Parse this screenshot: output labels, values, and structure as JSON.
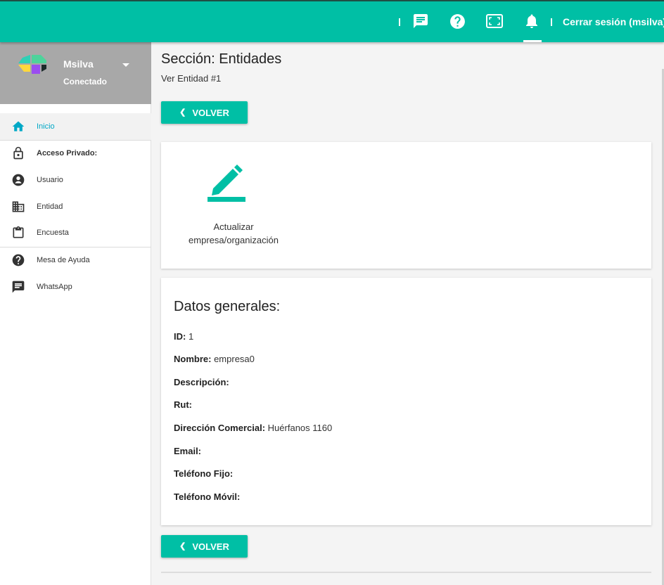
{
  "topbar": {
    "logout_label": "Cerrar sesión (msilva)",
    "icons": [
      "chat-icon",
      "help-icon",
      "fullscreen-icon",
      "bell-icon"
    ],
    "accent": "#00bfa5"
  },
  "profile": {
    "name": "Msilva",
    "status": "Conectado"
  },
  "sidebar": {
    "items": [
      {
        "label": "Inicio",
        "icon": "home-icon"
      },
      {
        "label": "Acceso Privado:",
        "icon": "lock-icon"
      },
      {
        "label": "Usuario",
        "icon": "account-icon"
      },
      {
        "label": "Entidad",
        "icon": "building-icon"
      },
      {
        "label": "Encuesta",
        "icon": "clipboard-icon"
      },
      {
        "label": "Mesa de Ayuda",
        "icon": "help-icon"
      },
      {
        "label": "WhatsApp",
        "icon": "chat-icon"
      }
    ]
  },
  "main": {
    "title": "Sección: Entidades",
    "subtitle": "Ver Entidad #1",
    "back_label": "VOLVER",
    "action_label": "Actualizar empresa/organización",
    "section_title": "Datos generales:",
    "fields": [
      {
        "label": "ID:",
        "value": "1"
      },
      {
        "label": "Nombre:",
        "value": "empresa0"
      },
      {
        "label": "Descripción:",
        "value": ""
      },
      {
        "label": "Rut:",
        "value": ""
      },
      {
        "label": "Dirección Comercial:",
        "value": "Huérfanos 1160"
      },
      {
        "label": "Email:",
        "value": ""
      },
      {
        "label": "Teléfono Fijo:",
        "value": ""
      },
      {
        "label": "Teléfono Móvil:",
        "value": ""
      }
    ]
  }
}
